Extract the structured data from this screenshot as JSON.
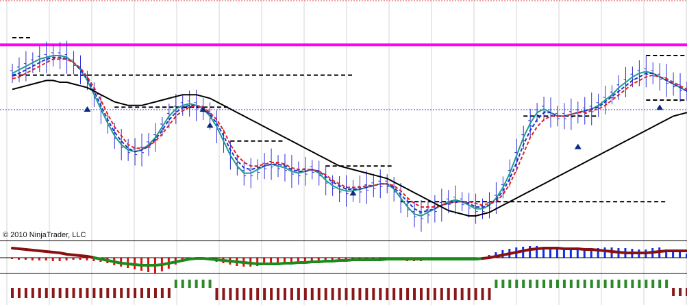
{
  "copyright": "© 2010 NinjaTrader, LLC",
  "colors": {
    "background": "#ffffff",
    "grid": "#d4d4d4",
    "price_bars": "#2b2bd6",
    "marker": "#0a2a80",
    "resistance": "#ff00ff",
    "levels": "#000000",
    "baseline": "#2f3fb0",
    "ma_teal": "#1f9a92",
    "ma_blue": "#1a33c8",
    "ma_red": "#e02020",
    "ma_black": "#000000",
    "ind1_red": "#e01010",
    "ind1_blue": "#1030e0",
    "ind1_green": "#1a8a1a",
    "ind1_maroon": "#8a1010",
    "ind2_green": "#2a8a2a",
    "ind2_maroon": "#8a1818"
  },
  "chart_data": {
    "type": "line",
    "x_count": 100,
    "y_range": [
      0,
      100
    ],
    "grid": true,
    "price_panel": {
      "series": [
        {
          "line": "ma_teal",
          "values": [
            80,
            82,
            84,
            86,
            88,
            89,
            90,
            90,
            89,
            86,
            82,
            76,
            68,
            60,
            52,
            45,
            40,
            37,
            36,
            37,
            40,
            44,
            50,
            56,
            60,
            62,
            63,
            62,
            60,
            56,
            50,
            42,
            34,
            28,
            24,
            24,
            26,
            28,
            29,
            28,
            27,
            25,
            24,
            25,
            26,
            24,
            20,
            17,
            15,
            14,
            14,
            15,
            16,
            17,
            18,
            18,
            15,
            10,
            5,
            1,
            0,
            2,
            4,
            6,
            8,
            9,
            8,
            6,
            4,
            4,
            6,
            10,
            16,
            24,
            34,
            44,
            52,
            58,
            60,
            58,
            56,
            56,
            57,
            58,
            59,
            60,
            62,
            65,
            68,
            72,
            75,
            78,
            80,
            81,
            80,
            78,
            76,
            74,
            72,
            70
          ]
        },
        {
          "line": "ma_blue",
          "dash": true,
          "values": [
            79,
            80,
            82,
            84,
            86,
            88,
            89,
            89,
            88,
            86,
            82,
            77,
            70,
            62,
            54,
            47,
            42,
            38,
            36,
            37,
            39,
            43,
            48,
            54,
            58,
            61,
            62,
            62,
            60,
            57,
            52,
            45,
            37,
            31,
            27,
            26,
            27,
            28,
            29,
            29,
            28,
            26,
            25,
            25,
            26,
            25,
            22,
            19,
            17,
            15,
            15,
            15,
            16,
            17,
            18,
            18,
            16,
            12,
            8,
            4,
            2,
            3,
            4,
            6,
            7,
            8,
            8,
            7,
            5,
            5,
            6,
            9,
            14,
            21,
            30,
            40,
            48,
            54,
            58,
            58,
            56,
            56,
            57,
            58,
            59,
            60,
            61,
            64,
            67,
            70,
            73,
            76,
            78,
            80,
            80,
            78,
            76,
            74,
            72,
            70
          ]
        },
        {
          "line": "ma_red",
          "dash": true,
          "values": [
            77,
            78,
            80,
            82,
            84,
            86,
            88,
            88,
            88,
            86,
            83,
            78,
            72,
            65,
            57,
            50,
            45,
            40,
            38,
            38,
            39,
            42,
            46,
            51,
            56,
            59,
            61,
            62,
            61,
            58,
            54,
            48,
            40,
            34,
            30,
            28,
            28,
            29,
            30,
            30,
            29,
            27,
            26,
            26,
            26,
            25,
            23,
            20,
            18,
            16,
            16,
            16,
            17,
            17,
            18,
            18,
            17,
            14,
            10,
            7,
            5,
            5,
            5,
            6,
            7,
            8,
            8,
            8,
            7,
            6,
            7,
            8,
            12,
            18,
            26,
            35,
            44,
            50,
            54,
            56,
            56,
            56,
            57,
            58,
            58,
            59,
            60,
            62,
            65,
            68,
            71,
            74,
            76,
            78,
            79,
            78,
            77,
            75,
            73,
            71
          ]
        },
        {
          "line": "ma_black",
          "values": [
            71,
            72,
            73,
            74,
            75,
            76,
            76,
            75,
            75,
            74,
            73,
            72,
            70,
            68,
            66,
            64,
            63,
            62,
            62,
            62,
            63,
            64,
            65,
            66,
            67,
            68,
            68,
            68,
            67,
            66,
            64,
            62,
            60,
            58,
            56,
            54,
            52,
            50,
            48,
            46,
            44,
            42,
            40,
            38,
            36,
            34,
            32,
            30,
            28,
            27,
            26,
            25,
            24,
            23,
            22,
            21,
            19,
            17,
            15,
            13,
            11,
            9,
            7,
            5,
            3,
            2,
            1,
            0,
            0,
            1,
            2,
            4,
            6,
            8,
            10,
            12,
            14,
            16,
            18,
            20,
            22,
            24,
            26,
            28,
            30,
            32,
            34,
            36,
            38,
            40,
            42,
            44,
            46,
            48,
            50,
            52,
            54,
            56,
            57,
            58
          ]
        }
      ],
      "resistance_level": 96,
      "levels": [
        [
          0,
          50,
          79
        ],
        [
          15,
          28,
          61
        ],
        [
          21,
          32,
          61
        ],
        [
          32,
          40,
          42
        ],
        [
          46,
          56,
          28
        ],
        [
          57,
          96,
          8
        ],
        [
          75,
          86,
          56
        ],
        [
          93,
          100,
          90
        ],
        [
          0,
          3,
          100
        ],
        [
          93,
          100,
          65
        ]
      ],
      "markers": [
        [
          11,
          60
        ],
        [
          28,
          60
        ],
        [
          29,
          51
        ],
        [
          50,
          13
        ],
        [
          83,
          39
        ],
        [
          95,
          61
        ]
      ]
    },
    "indicator_1": {
      "histogram": [
        -2,
        -3,
        -3,
        -4,
        -4,
        -4,
        -5,
        -5,
        -4,
        -3,
        -3,
        -4,
        -5,
        -6,
        -8,
        -11,
        -13,
        -15,
        -17,
        -19,
        -21,
        -23,
        -20,
        -16,
        -10,
        -5,
        -2,
        0,
        -2,
        -4,
        -6,
        -8,
        -10,
        -12,
        -13,
        -13,
        -12,
        -11,
        -10,
        -9,
        -9,
        -8,
        -8,
        -7,
        -6,
        -6,
        -5,
        -4,
        -3,
        -3,
        -3,
        -3,
        -3,
        -2,
        -2,
        -3,
        -3,
        -4,
        -5,
        -5,
        -5,
        -4,
        -4,
        -3,
        -3,
        -3,
        -2,
        -2,
        -2,
        -2,
        4,
        8,
        11,
        13,
        15,
        16,
        17,
        17,
        15,
        12,
        12,
        13,
        14,
        15,
        14,
        13,
        14,
        15,
        15,
        14,
        14,
        13,
        12,
        12,
        14,
        15,
        12,
        10,
        8,
        6
      ],
      "signal": [
        14,
        13,
        12,
        11,
        10,
        9,
        8,
        7,
        5,
        4,
        3,
        2,
        0,
        -2,
        -4,
        -6,
        -8,
        -9,
        -10,
        -11,
        -11,
        -11,
        -10,
        -8,
        -6,
        -4,
        -2,
        -1,
        -1,
        -2,
        -3,
        -4,
        -5,
        -6,
        -7,
        -8,
        -9,
        -9,
        -9,
        -9,
        -8,
        -8,
        -7,
        -7,
        -6,
        -6,
        -5,
        -5,
        -4,
        -4,
        -3,
        -3,
        -3,
        -3,
        -3,
        -2,
        -2,
        -2,
        -2,
        -2,
        -2,
        -2,
        -2,
        -2,
        -2,
        -2,
        -2,
        -2,
        -2,
        -1,
        0,
        2,
        4,
        6,
        8,
        10,
        12,
        13,
        14,
        14,
        14,
        13,
        13,
        13,
        12,
        12,
        11,
        10,
        9,
        8,
        7,
        7,
        7,
        7,
        8,
        9,
        10,
        10,
        10,
        10
      ]
    },
    "indicator_2": {
      "bars": [
        -15,
        -15,
        -15,
        -15,
        -15,
        -15,
        -15,
        -15,
        -15,
        -15,
        -15,
        -15,
        -15,
        -15,
        -15,
        -15,
        -15,
        -15,
        -15,
        -15,
        -15,
        -15,
        -15,
        -15,
        12,
        12,
        12,
        12,
        12,
        12,
        -18,
        -18,
        -18,
        -18,
        -18,
        -18,
        -18,
        -18,
        -18,
        -18,
        -18,
        -18,
        -18,
        -18,
        -18,
        -18,
        -18,
        -18,
        -18,
        -18,
        -18,
        -18,
        -18,
        -18,
        -18,
        -18,
        -18,
        -18,
        -18,
        -18,
        -18,
        -18,
        -18,
        -18,
        -18,
        -18,
        -18,
        -18,
        -18,
        -18,
        -18,
        12,
        12,
        12,
        12,
        12,
        12,
        12,
        12,
        12,
        12,
        12,
        12,
        12,
        12,
        12,
        12,
        12,
        12,
        12,
        12,
        12,
        12,
        12,
        12,
        12,
        12,
        -12,
        -12,
        -12
      ]
    }
  }
}
